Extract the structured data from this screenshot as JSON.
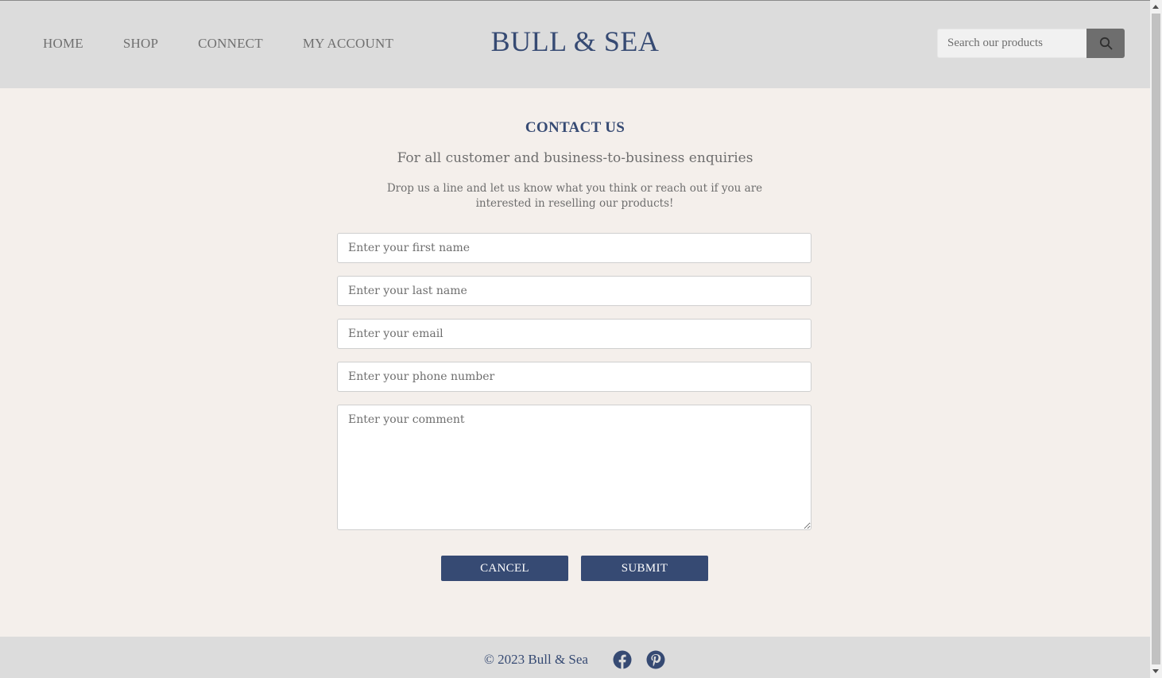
{
  "header": {
    "nav": [
      {
        "label": "HOME"
      },
      {
        "label": "SHOP"
      },
      {
        "label": "CONNECT"
      },
      {
        "label": "MY ACCOUNT"
      }
    ],
    "logo": "BULL & SEA",
    "search": {
      "placeholder": "Search our products",
      "icon": "search-icon"
    }
  },
  "main": {
    "title": "CONTACT US",
    "subtitle": "For all customer and business-to-business enquiries",
    "description": "Drop us a line and let us know what you think or reach out if you are interested in reselling our products!",
    "form": {
      "first_name_placeholder": "Enter your first name",
      "last_name_placeholder": "Enter your last name",
      "email_placeholder": "Enter your email",
      "phone_placeholder": "Enter your phone number",
      "comment_placeholder": "Enter your comment",
      "cancel_label": "CANCEL",
      "submit_label": "SUBMIT"
    }
  },
  "footer": {
    "copyright": "© 2023 Bull & Sea",
    "social": [
      {
        "icon": "facebook-icon"
      },
      {
        "icon": "pinterest-icon"
      }
    ]
  },
  "colors": {
    "brand": "#364a73",
    "header_bg": "#dcdcdc",
    "page_bg": "#f4efeb"
  }
}
